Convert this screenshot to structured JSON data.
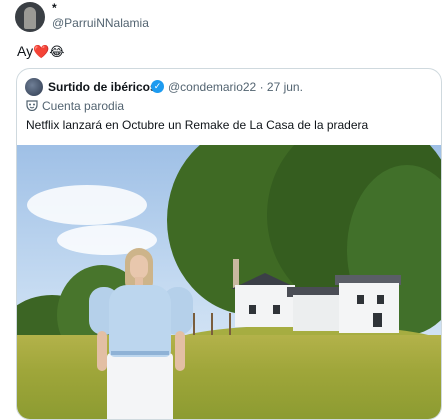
{
  "post": {
    "author_name": "*",
    "author_handle": "@ParruiNNalamia",
    "text": "Ay",
    "emoji_heart": "❤️",
    "emoji_laugh": "😂"
  },
  "quote": {
    "name": "Surtido de ibéricos",
    "handle_date": "@condemario22 · 27 jun.",
    "parody_label": "Cuenta parodia",
    "text": "Netflix lanzará en Octubre un  Remake de La Casa de la pradera"
  },
  "colors": {
    "verified": "#1d9bf0",
    "muted_text": "#536471",
    "border": "#cfd9de"
  },
  "icons": [
    "avatar",
    "verified-badge-icon",
    "parody-mask-icon"
  ]
}
